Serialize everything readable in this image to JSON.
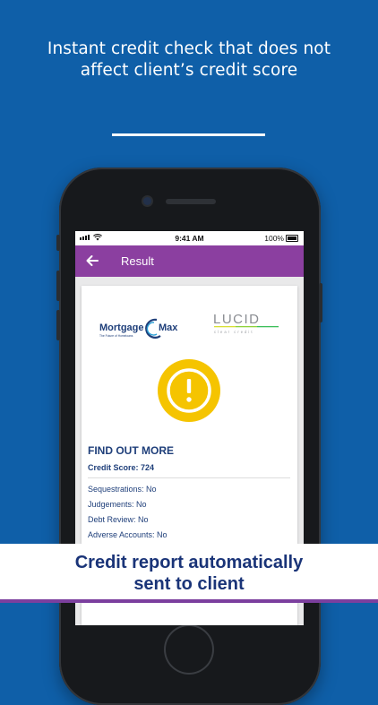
{
  "headline": {
    "line1": "Instant credit check that does not",
    "line2": "affect client’s credit score"
  },
  "status_bar": {
    "time": "9:41 AM",
    "battery": "100%"
  },
  "app_bar": {
    "title": "Result"
  },
  "card": {
    "left_logo": {
      "brand_left": "Mortgage",
      "brand_right": "Max",
      "tagline": "The Future of Homeloans"
    },
    "right_logo": {
      "brand": "LUCID",
      "tagline": "clear credit"
    },
    "heading": "FIND OUT MORE",
    "credit_score": "Credit Score: 724",
    "details": [
      "Sequestrations: No",
      "Judgements: No",
      "Debt Review: No",
      "Adverse Accounts: No"
    ]
  },
  "banner": {
    "line1": "Credit report automatically",
    "line2": "sent to client"
  },
  "colors": {
    "background": "#0f5fa8",
    "app_bar": "#8b3fa0",
    "alert": "#f5c400",
    "text_navy": "#1f3f7a",
    "banner_text": "#1a3478"
  }
}
